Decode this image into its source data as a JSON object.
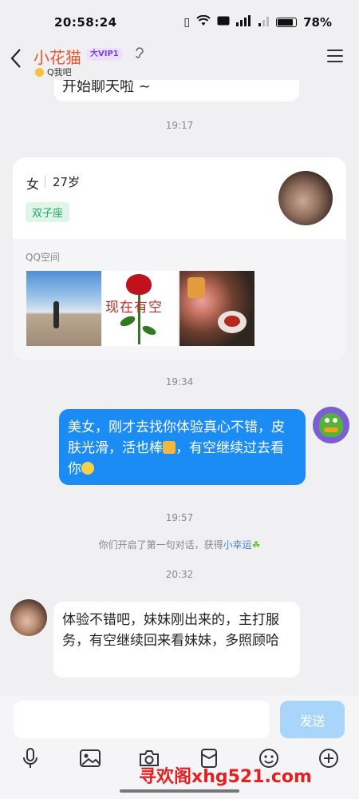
{
  "status_bar": {
    "time": "20:58:24",
    "battery": "78%"
  },
  "header": {
    "back_icon": "chevron-left-icon",
    "contact_name": "小花猫",
    "vip_badge": "大VIP1",
    "status_text": "Q我吧",
    "menu_icon": "menu-icon"
  },
  "chat": {
    "partial_message": "开始聊天啦 ~",
    "timestamps": [
      "19:17",
      "19:34",
      "19:57",
      "20:32"
    ],
    "profile_card": {
      "gender": "女",
      "age": "27岁",
      "zodiac": "双子座",
      "qzone_label": "QQ空间",
      "rose_photo_text": "现在有空"
    },
    "my_message": {
      "text_part1": "美女，刚才去找你体验真心不错，皮肤光滑，活也棒",
      "text_part2": "，有空继续过去看你"
    },
    "system_message": {
      "text": "你们开启了第一句对话，获得",
      "link": "小幸运"
    },
    "their_message": {
      "text": "体验不错吧，妹妹刚出来的，主打服务，有空继续回来看妹妹，多照顾哈"
    }
  },
  "input": {
    "placeholder": "",
    "send_label": "发送",
    "toolbar_icons": [
      "mic-icon",
      "image-icon",
      "camera-icon",
      "red-packet-icon",
      "emoji-icon",
      "plus-icon"
    ]
  },
  "watermark": "寻欢阁xhg521.com",
  "colors": {
    "accent": "#1c8cf5",
    "name_color": "#e5582b",
    "send_disabled": "#a9d5fb",
    "background": "#f0f0f2"
  }
}
